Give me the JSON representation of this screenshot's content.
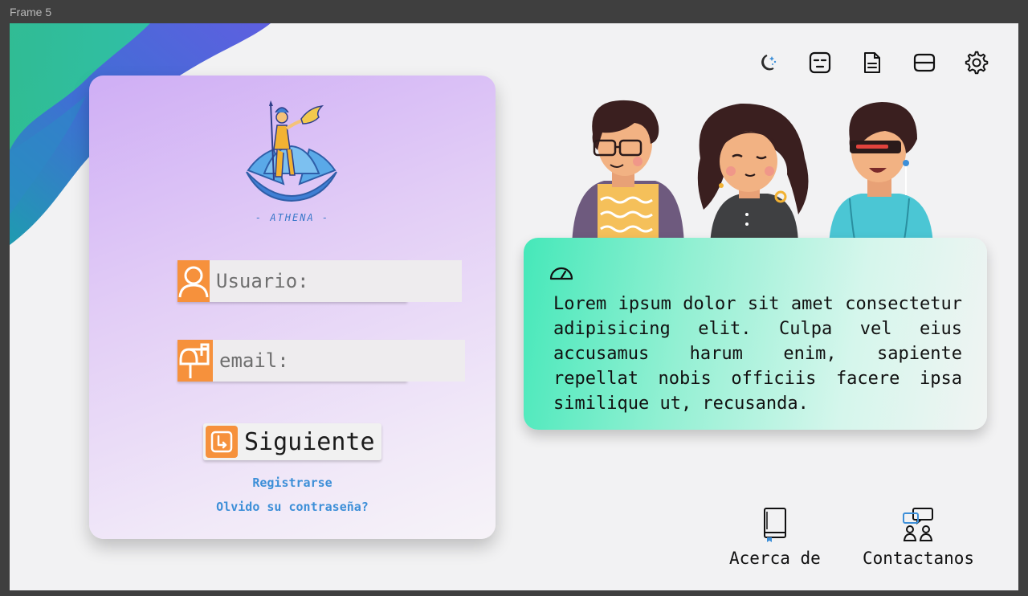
{
  "frame": {
    "label": "Frame 5"
  },
  "topbar": {
    "icons": [
      "moon-stars-icon",
      "sleepy-face-icon",
      "document-icon",
      "inbox-icon",
      "gear-icon"
    ]
  },
  "login": {
    "logo_text": "- ATHENA -",
    "username_placeholder": "Usuario:",
    "email_placeholder": "email:",
    "next_label": "Siguiente",
    "register_link": "Registrarse",
    "forgot_link": "Olvido su contraseña?"
  },
  "info": {
    "text": "Lorem ipsum dolor sit amet consectetur adipisicing elit. Culpa vel eius accusamus harum enim, sapiente repellat nobis officiis facere ipsa similique ut, recusanda."
  },
  "bottom_nav": {
    "about_label": "Acerca de",
    "contact_label": "Contactanos"
  },
  "colors": {
    "accent_orange": "#f6913c",
    "link_blue": "#3d8fd8",
    "card_purple": "#cfaef5",
    "info_green": "#45e8b9"
  }
}
